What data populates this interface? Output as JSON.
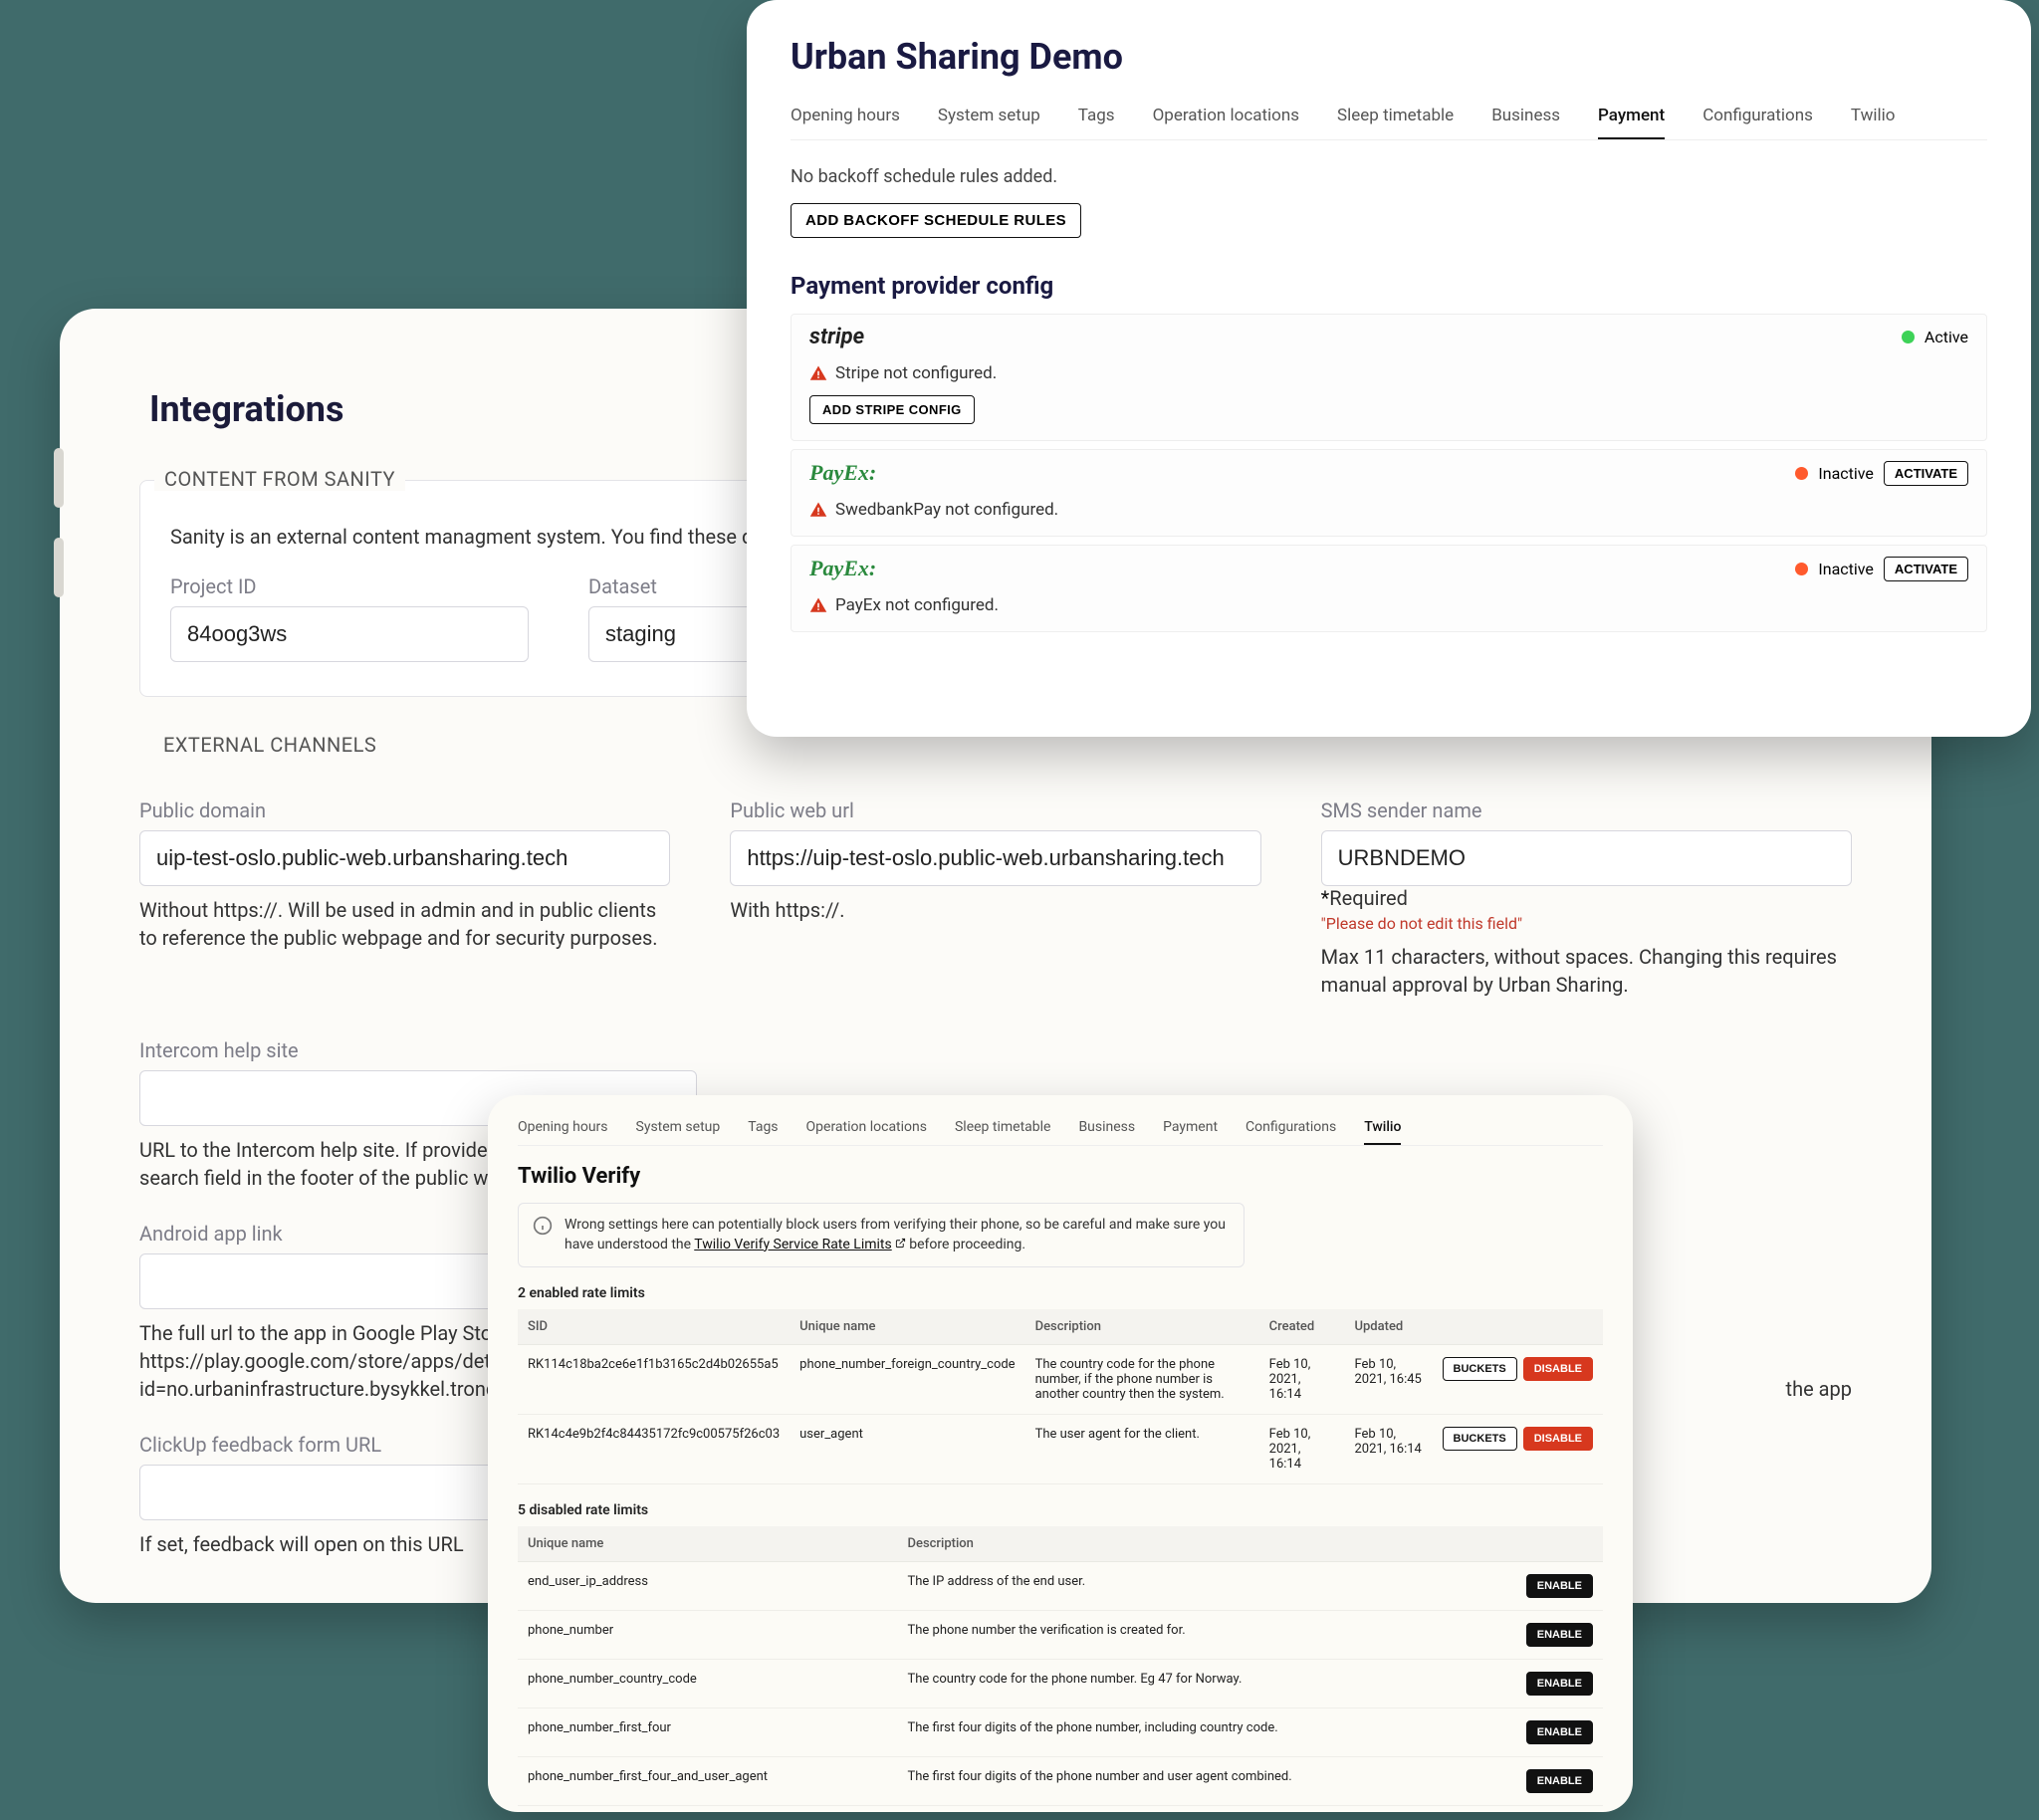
{
  "integrations": {
    "title": "Integrations",
    "sanity": {
      "legend": "CONTENT FROM SANITY",
      "desc": "Sanity is an external content managment system. You find these details b",
      "project_id_label": "Project ID",
      "project_id_value": "84oog3ws",
      "dataset_label": "Dataset",
      "dataset_value": "staging"
    },
    "channels": {
      "legend": "EXTERNAL CHANNELS",
      "public_domain_label": "Public domain",
      "public_domain_value": "uip-test-oslo.public-web.urbansharing.tech",
      "public_domain_help": "Without https://. Will be used in admin and in public clients to reference the public webpage and for security purposes.",
      "public_web_label": "Public web url",
      "public_web_value": "https://uip-test-oslo.public-web.urbansharing.tech",
      "public_web_help": "With https://.",
      "sms_label": "SMS sender name",
      "sms_value": "URBNDEMO",
      "sms_required": "Required",
      "sms_warn": "\"Please do not edit this field\"",
      "sms_help": "Max 11 characters, without spaces. Changing this requires manual approval by Urban Sharing.",
      "intercom_label": "Intercom help site",
      "intercom_help": "URL to the Intercom help site. If provided, it will display a search field in the footer of the public web site.",
      "android_label": "Android app link",
      "android_help": "The full url to the app in Google Play Store, e.g. https://play.google.com/store/apps/details?id=no.urbaninfrastructure.bysykkel.trondheim",
      "ios_help_tail": "the app",
      "clickup_label": "ClickUp feedback form URL",
      "clickup_help": "If set, feedback will open on this URL"
    }
  },
  "demo": {
    "title": "Urban Sharing Demo",
    "tabs": [
      "Opening hours",
      "System setup",
      "Tags",
      "Operation locations",
      "Sleep timetable",
      "Business",
      "Payment",
      "Configurations",
      "Twilio"
    ],
    "active_tab": "Payment",
    "backoff_note": "No backoff schedule rules added.",
    "backoff_btn": "ADD BACKOFF SCHEDULE RULES",
    "section": "Payment provider config",
    "providers": [
      {
        "name": "stripe",
        "logo": "stripe",
        "status": "Active",
        "status_color": "green",
        "warn": "Stripe not configured.",
        "action": "ADD STRIPE CONFIG",
        "activate_btn": ""
      },
      {
        "name": "PayEx",
        "logo": "payex",
        "status": "Inactive",
        "status_color": "red",
        "warn": "SwedbankPay not configured.",
        "action": "",
        "activate_btn": "ACTIVATE"
      },
      {
        "name": "PayEx",
        "logo": "payex",
        "status": "Inactive",
        "status_color": "red",
        "warn": "PayEx not configured.",
        "action": "",
        "activate_btn": "ACTIVATE"
      }
    ]
  },
  "twilio": {
    "tabs": [
      "Opening hours",
      "System setup",
      "Tags",
      "Operation locations",
      "Sleep timetable",
      "Business",
      "Payment",
      "Configurations",
      "Twilio"
    ],
    "active_tab": "Twilio",
    "title": "Twilio Verify",
    "callout_pre": "Wrong settings here can potentially block users from verifying their phone, so be careful and make sure you have understood the ",
    "callout_link": "Twilio Verify Service Rate Limits",
    "callout_post": " before proceeding.",
    "enabled_label": "2 enabled rate limits",
    "enabled_cols": [
      "SID",
      "Unique name",
      "Description",
      "Created",
      "Updated",
      ""
    ],
    "enabled": [
      {
        "sid": "RK114c18ba2ce6e1f1b3165c2d4b02655a5",
        "name": "phone_number_foreign_country_code",
        "desc": "The country code for the phone number, if the phone number is another country then the system.",
        "created": "Feb 10, 2021, 16:14",
        "updated": "Feb 10, 2021, 16:45",
        "btn1": "BUCKETS",
        "btn2": "DISABLE"
      },
      {
        "sid": "RK14c4e9b2f4c84435172fc9c00575f26c03",
        "name": "user_agent",
        "desc": "The user agent for the client.",
        "created": "Feb 10, 2021, 16:14",
        "updated": "Feb 10, 2021, 16:14",
        "btn1": "BUCKETS",
        "btn2": "DISABLE"
      }
    ],
    "disabled_label": "5 disabled rate limits",
    "disabled_cols": [
      "Unique name",
      "Description",
      ""
    ],
    "disabled": [
      {
        "name": "end_user_ip_address",
        "desc": "The IP address of the end user.",
        "btn": "ENABLE"
      },
      {
        "name": "phone_number",
        "desc": "The phone number the verification is created for.",
        "btn": "ENABLE"
      },
      {
        "name": "phone_number_country_code",
        "desc": "The country code for the phone number. Eg 47 for Norway.",
        "btn": "ENABLE"
      },
      {
        "name": "phone_number_first_four",
        "desc": "The first four digits of the phone number, including country code.",
        "btn": "ENABLE"
      },
      {
        "name": "phone_number_first_four_and_user_agent",
        "desc": "The first four digits of the phone number and user agent combined.",
        "btn": "ENABLE"
      }
    ]
  }
}
